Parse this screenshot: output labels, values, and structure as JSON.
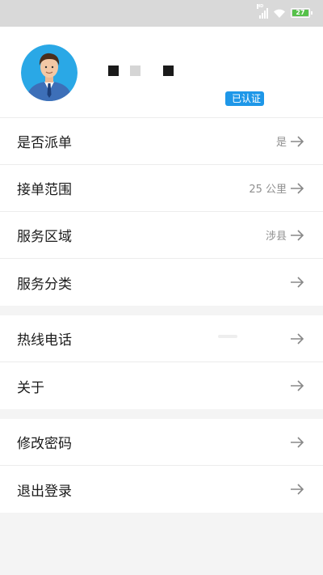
{
  "status_bar": {
    "signal_label": "HD",
    "battery_level": "27"
  },
  "profile": {
    "badge": "已认证"
  },
  "settings_group_1": [
    {
      "label": "是否派单",
      "value": "是"
    },
    {
      "label": "接单范围",
      "value": "25 公里"
    },
    {
      "label": "服务区域",
      "value": "涉县"
    },
    {
      "label": "服务分类",
      "value": ""
    }
  ],
  "settings_group_2": [
    {
      "label": "热线电话",
      "value": ""
    },
    {
      "label": "关于",
      "value": ""
    }
  ],
  "settings_group_3": [
    {
      "label": "修改密码",
      "value": ""
    },
    {
      "label": "退出登录",
      "value": ""
    }
  ],
  "colors": {
    "accent": "#1e97e8",
    "battery": "#56c14a",
    "status_bar": "#d9d9d9"
  }
}
